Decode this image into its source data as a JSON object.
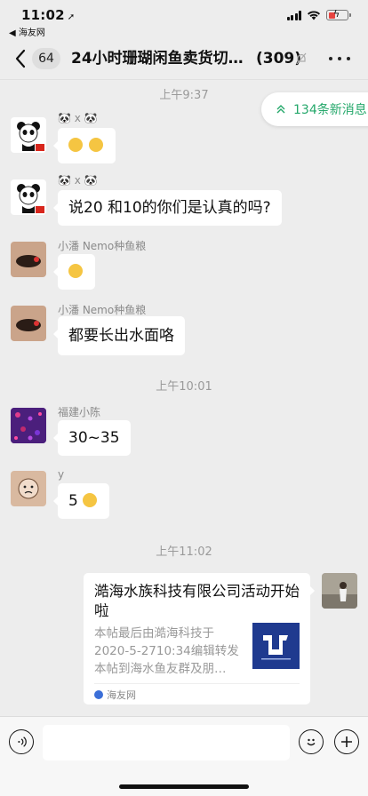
{
  "status": {
    "time": "11:02",
    "back_app": "◀ 海友网"
  },
  "nav": {
    "unread": "64",
    "title": "24小时珊瑚闲鱼卖货切…",
    "member_count": "(309)"
  },
  "new_messages": "134条新消息",
  "messages": [
    {
      "kind": "time",
      "text": "上午9:37"
    },
    {
      "sender": "🐼 x 🐼",
      "text": ""
    },
    {
      "sender": "🐼 x 🐼",
      "text": "说20 和10的你们是认真的吗?"
    },
    {
      "sender": "小潘 Nemo种鱼粮",
      "text": ""
    },
    {
      "sender": "小潘 Nemo种鱼粮",
      "text": "都要长出水面咯"
    },
    {
      "kind": "time",
      "text": "上午10:01"
    },
    {
      "sender": "福建小陈",
      "text": "30~35"
    },
    {
      "sender": "y",
      "text": "5"
    },
    {
      "kind": "time",
      "text": "上午11:02"
    }
  ],
  "link_card": {
    "title": "澔海水族科技有限公司活动开始啦",
    "description": "本帖最后由澔海科技于 2020-5-2710:34编辑转发本帖到海水鱼友群及朋…",
    "source": "海友网",
    "thumb_text": "澔海"
  },
  "input": {
    "placeholder": ""
  },
  "colors": {
    "accent_green": "#25a86b",
    "chat_bg": "#ededed",
    "bubble": "#ffffff"
  }
}
